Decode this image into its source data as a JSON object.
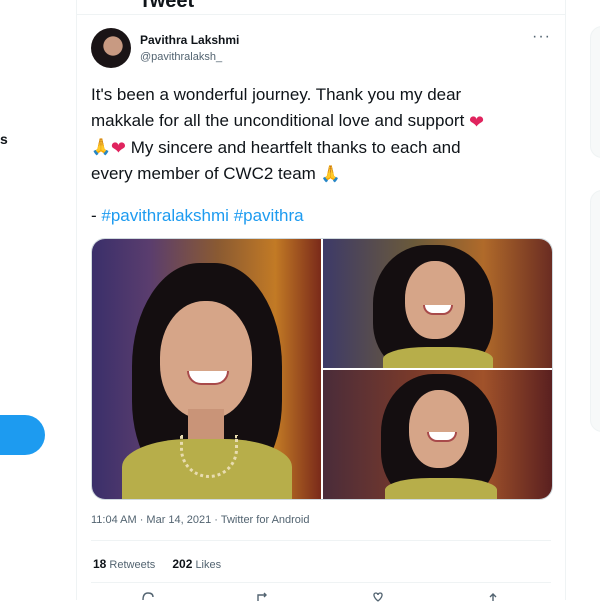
{
  "nav": {
    "label_fragment": "s"
  },
  "header": {
    "title": "Tweet"
  },
  "tweet": {
    "author_name": "Pavithra Lakshmi",
    "author_handle": "@pavithralaksh_",
    "more_glyph": "···",
    "text_lines": [
      "It's been a wonderful journey. Thank you my dear",
      "makkale for all the unconditional love and support",
      "My sincere and heartfelt thanks to each and",
      "every member of CWC2 team"
    ],
    "hashtag_prefix": "- ",
    "hashtags": [
      "#pavithralakshmi",
      "#pavithra"
    ],
    "emoji": {
      "heart": "❤",
      "folded_hands": "🙏"
    },
    "timestamp": "11:04 AM · Mar 14, 2021 · Twitter for Android",
    "retweets_count": "18",
    "retweets_label": "Retweets",
    "likes_count": "202",
    "likes_label": "Likes"
  },
  "colors": {
    "accent": "#1d9bf0",
    "heart": "#e0245e",
    "text": "#0f1419",
    "muted": "#536471"
  },
  "icons": [
    "more-icon",
    "reply-icon",
    "retweet-icon",
    "like-icon",
    "share-icon"
  ]
}
